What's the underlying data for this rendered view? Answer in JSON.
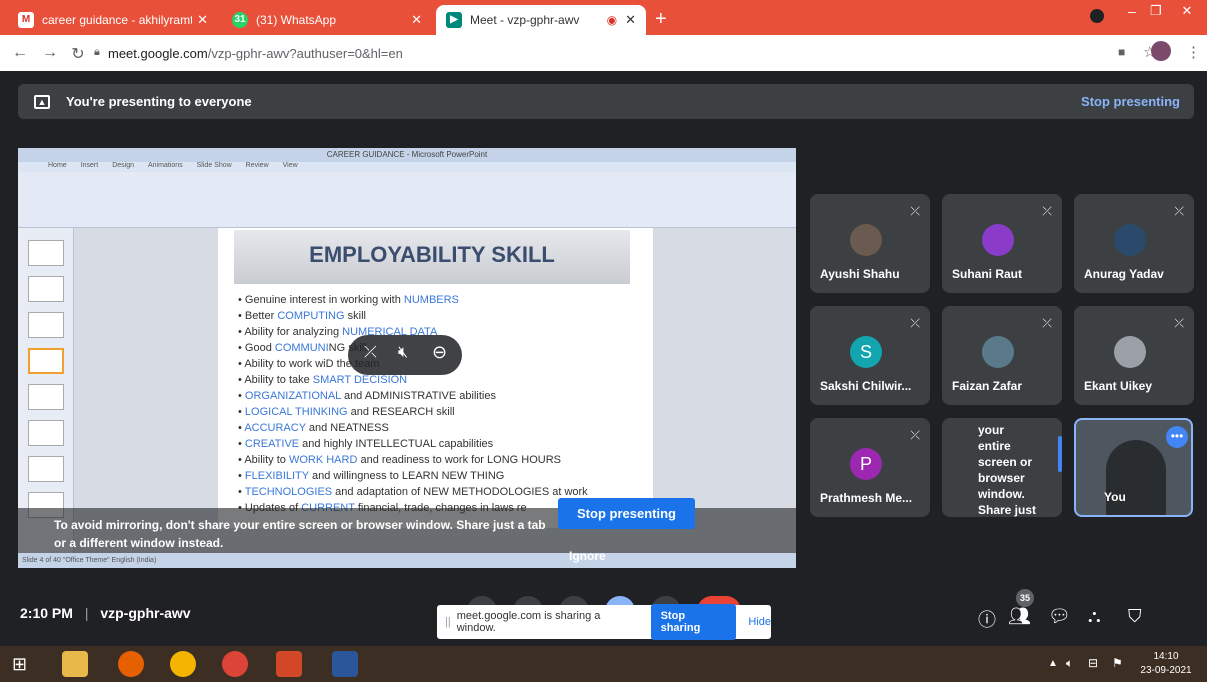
{
  "browser": {
    "tabs": [
      {
        "label": "career guidance - akhilyramteke",
        "icon": "gmail-icon"
      },
      {
        "label": "(31) WhatsApp",
        "icon": "whatsapp-icon",
        "badge": "31"
      },
      {
        "label": "Meet - vzp-gphr-awv",
        "icon": "meet-icon"
      }
    ],
    "new_tab": "+",
    "url_host": "meet.google.com",
    "url_path": "/vzp-gphr-awv?authuser=0&hl=en"
  },
  "presenting": {
    "banner_text": "You're presenting to everyone",
    "stop_label": "Stop presenting"
  },
  "slide": {
    "window_title": "CAREER GUIDANCE - Microsoft PowerPoint",
    "ribbon_tabs": [
      "Home",
      "Insert",
      "Design",
      "Animations",
      "Slide Show",
      "Review",
      "View"
    ],
    "heading": "EMPLOYABILITY SKILL",
    "bullets": [
      {
        "pre": "Genuine interest in working with ",
        "hl": "NUMBERS",
        "post": ""
      },
      {
        "pre": "Better ",
        "hl": "COMPUTING",
        "post": " skill"
      },
      {
        "pre": "Ability for analyzing ",
        "hl": "NUMERICAL DATA",
        "post": ""
      },
      {
        "pre": "Good ",
        "hl": "COMMUNI",
        "post": "NG skill"
      },
      {
        "pre": "Ability to work wi",
        "hl": "",
        "post": "D the team"
      },
      {
        "pre": "Ability to take ",
        "hl": "SMART DECISION",
        "post": ""
      },
      {
        "pre": "",
        "hl": "ORGANIZATIONAL",
        "post": " and ADMINISTRATIVE abilities"
      },
      {
        "pre": "",
        "hl": "LOGICAL THINKING",
        "post": " and RESEARCH skill"
      },
      {
        "pre": "",
        "hl": "ACCURACY",
        "post": " and NEATNESS"
      },
      {
        "pre": "",
        "hl": "CREATIVE",
        "post": " and highly INTELLECTUAL capabilities"
      },
      {
        "pre": "Ability to ",
        "hl": "WORK HARD",
        "post": " and readiness to work for LONG HOURS"
      },
      {
        "pre": "",
        "hl": "FLEXIBILITY",
        "post": " and willingness to LEARN NEW THING"
      },
      {
        "pre": "",
        "hl": "TECHNOLOGIES",
        "post": " and adaptation of NEW METHODOLOGIES at work"
      },
      {
        "pre": "Updates of ",
        "hl": "CURRENT",
        "post": " financial, trade, changes in laws re"
      }
    ],
    "status_text": "Slide 4 of 40   \"Office Theme\"   English (India)"
  },
  "mirror_warning": {
    "text": "To avoid mirroring, don't share your entire screen or browser window. Share just a tab or a different window instead.",
    "stop_label": "Stop presenting",
    "ignore_label": "Ignore"
  },
  "participants": [
    {
      "name": "Ayushi Shahu",
      "avatar": "photo",
      "color": "#6b5a50"
    },
    {
      "name": "Suhani Raut",
      "avatar": "photo",
      "color": "#8a3cc8"
    },
    {
      "name": "Anurag Yadav",
      "avatar": "photo",
      "color": "#2b4a6b"
    },
    {
      "name": "Sakshi Chilwir...",
      "avatar": "S",
      "color": "#12a4af"
    },
    {
      "name": "Faizan Zafar",
      "avatar": "photo",
      "color": "#5a7a8a"
    },
    {
      "name": "Ekant Uikey",
      "avatar": "photo",
      "color": "#9aa0a6"
    },
    {
      "name": "Prathmesh Me...",
      "avatar": "P",
      "color": "#9c27b0"
    }
  ],
  "overflow_tile_text": "your entire screen or browser window. Share just",
  "self_tile_label": "You",
  "meeting": {
    "time": "2:10 PM",
    "code": "vzp-gphr-awv",
    "participant_count": "35"
  },
  "share_bar": {
    "text": "meet.google.com is sharing a window.",
    "stop_label": "Stop sharing",
    "hide_label": "Hide"
  },
  "taskbar": {
    "time": "14:10",
    "date": "23-09-2021"
  }
}
